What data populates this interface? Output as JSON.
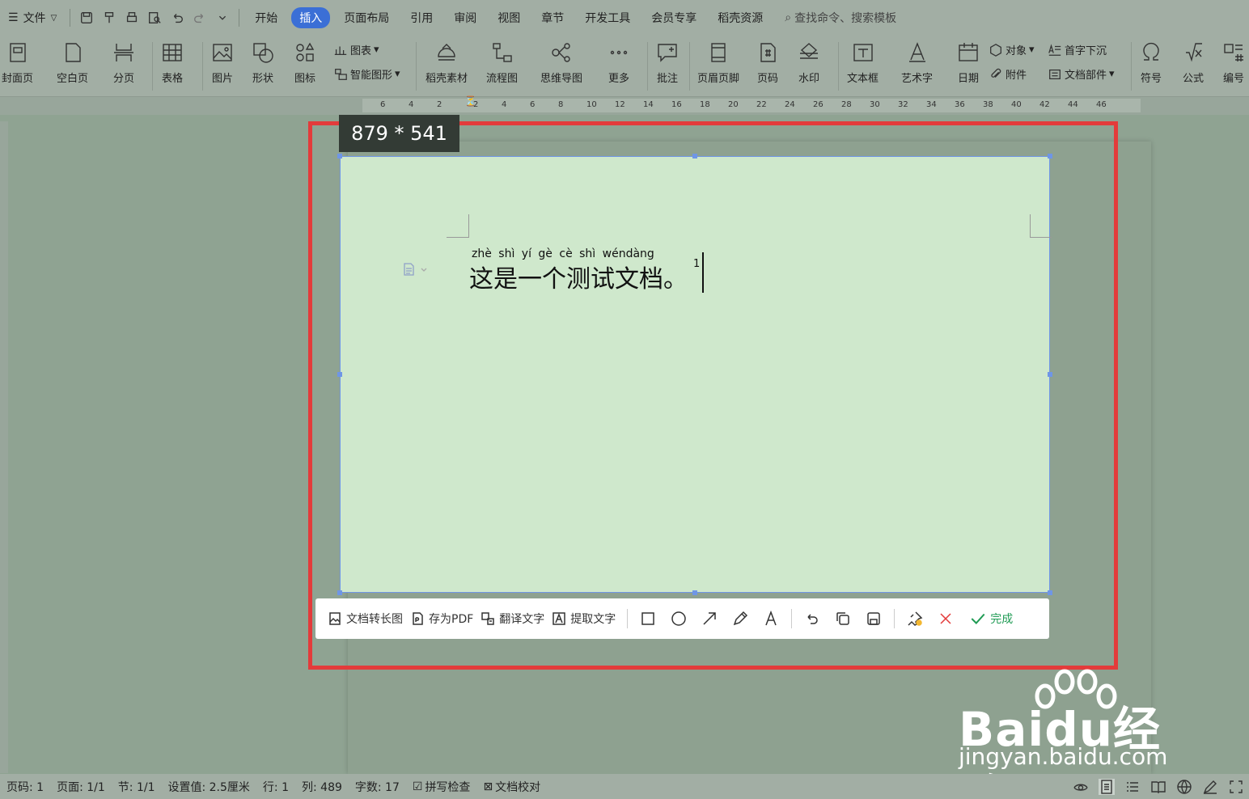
{
  "menubar": {
    "file": "文件",
    "tabs": [
      "开始",
      "插入",
      "页面布局",
      "引用",
      "审阅",
      "视图",
      "章节",
      "开发工具",
      "会员专享",
      "稻壳资源"
    ],
    "active_tab": "插入",
    "search_placeholder": "查找命令、搜索模板"
  },
  "ribbon": {
    "cover": "封面页",
    "blank": "空白页",
    "pagebreak": "分页",
    "table": "表格",
    "picture": "图片",
    "shape": "形状",
    "icon": "图标",
    "chart": "图表",
    "smartart": "智能图形",
    "material": "稻壳素材",
    "flowchart": "流程图",
    "mindmap": "思维导图",
    "more": "更多",
    "comment": "批注",
    "headerfooter": "页眉页脚",
    "pagenum": "页码",
    "watermark": "水印",
    "textbox": "文本框",
    "wordart": "艺术字",
    "date": "日期",
    "object": "对象",
    "attachment": "附件",
    "dropcap": "首字下沉",
    "docpart": "文档部件",
    "symbol": "符号",
    "formula": "公式",
    "numbering": "编号"
  },
  "ruler": {
    "ticks": [
      "6",
      "4",
      "2",
      "2",
      "4",
      "6",
      "8",
      "10",
      "12",
      "14",
      "16",
      "18",
      "20",
      "22",
      "24",
      "26",
      "28",
      "30",
      "32",
      "34",
      "36",
      "38",
      "40",
      "42",
      "44",
      "46"
    ]
  },
  "capture": {
    "size": "879 * 541",
    "pinyin": "zhè  shì  yí  gè  cè  shì wéndàng",
    "text": "这是一个测试文档。",
    "footnote": "1"
  },
  "toolbar": {
    "to_long_image": "文档转长图",
    "save_pdf": "存为PDF",
    "translate": "翻译文字",
    "extract": "提取文字",
    "done": "完成"
  },
  "watermark": {
    "brand": "Baidu经验",
    "url": "jingyan.baidu.com"
  },
  "status": {
    "page_num": "页码: 1",
    "pages": "页面: 1/1",
    "section": "节: 1/1",
    "setting": "设置值: 2.5厘米",
    "row": "行: 1",
    "col": "列: 489",
    "wordcount": "字数: 17",
    "spellcheck": "拼写检查",
    "proofread": "文档校对"
  },
  "colors": {
    "accent": "#3b6fd6",
    "frame": "#e33b3b",
    "capture_bg": "#cfe8cc",
    "done": "#1f9b54"
  }
}
